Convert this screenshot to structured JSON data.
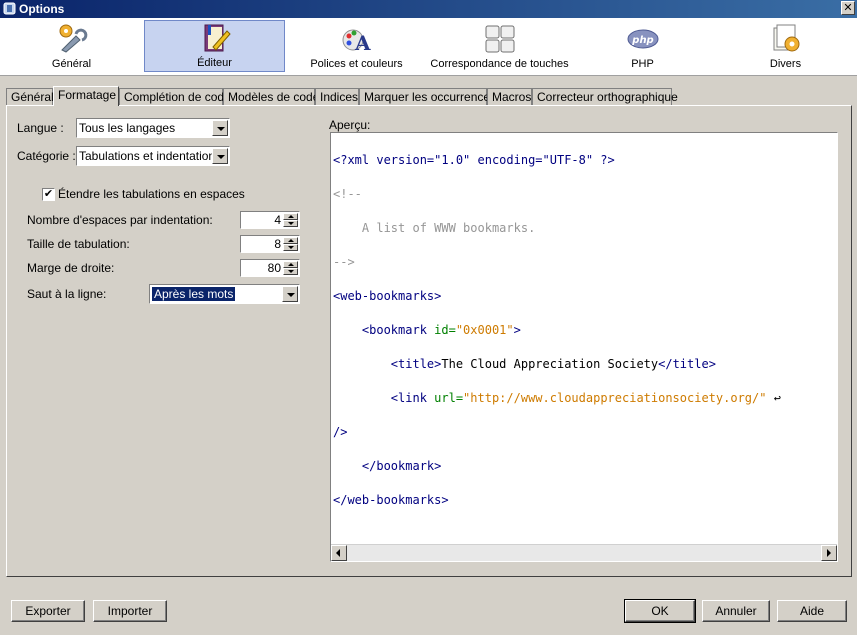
{
  "window": {
    "title": "Options",
    "close_label": "✕"
  },
  "toolbar": {
    "categories": [
      {
        "label": "Général",
        "icon": "gears-icon"
      },
      {
        "label": "Éditeur",
        "icon": "book-pen-icon",
        "selected": true
      },
      {
        "label": "Polices et couleurs",
        "icon": "font-palette-icon"
      },
      {
        "label": "Correspondance de touches",
        "icon": "keyboard-keys-icon"
      },
      {
        "label": "PHP",
        "icon": "php-icon"
      },
      {
        "label": "Divers",
        "icon": "folder-gear-icon"
      }
    ]
  },
  "tabs": [
    "Général",
    "Formatage",
    "Complétion de code",
    "Modèles de code",
    "Indices",
    "Marquer les occurrences",
    "Macros",
    "Correcteur orthographique"
  ],
  "active_tab": "Formatage",
  "form": {
    "language_label": "Langue :",
    "language_value": "Tous les langages",
    "category_label": "Catégorie :",
    "category_value": "Tabulations et indentations",
    "expand_tabs_label": "Étendre les tabulations en espaces",
    "expand_tabs_checked": "✔",
    "indent_spaces_label": "Nombre d'espaces par indentation:",
    "indent_spaces_value": "4",
    "tab_size_label": "Taille de tabulation:",
    "tab_size_value": "8",
    "right_margin_label": "Marge de droite:",
    "right_margin_value": "80",
    "line_wrap_label": "Saut à la ligne:",
    "line_wrap_value": "Après les mots"
  },
  "preview": {
    "label": "Aperçu:",
    "lines": {
      "l1": "<?xml version=\"1.0\" encoding=\"UTF-8\" ?>",
      "l2": "<!--",
      "l3": "    A list of WWW bookmarks.",
      "l4": "-->",
      "l5": "<web-bookmarks>",
      "l6_tag": "    <bookmark",
      "l6_attr": " id=",
      "l6_str": "\"0x0001\"",
      "l6_end": ">",
      "l7_open": "        <title>",
      "l7_text": "The Cloud Appreciation Society",
      "l7_close": "</title>",
      "l8_tag": "        <link",
      "l8_attr": " url=",
      "l8_str": "\"http://www.cloudappreciationsociety.org/\"",
      "l8_wrap": " ↩",
      "l9": "/>",
      "l10": "    </bookmark>",
      "l11": "</web-bookmarks>"
    }
  },
  "buttons": {
    "export": "Exporter",
    "import": "Importer",
    "ok": "OK",
    "cancel": "Annuler",
    "help": "Aide"
  }
}
